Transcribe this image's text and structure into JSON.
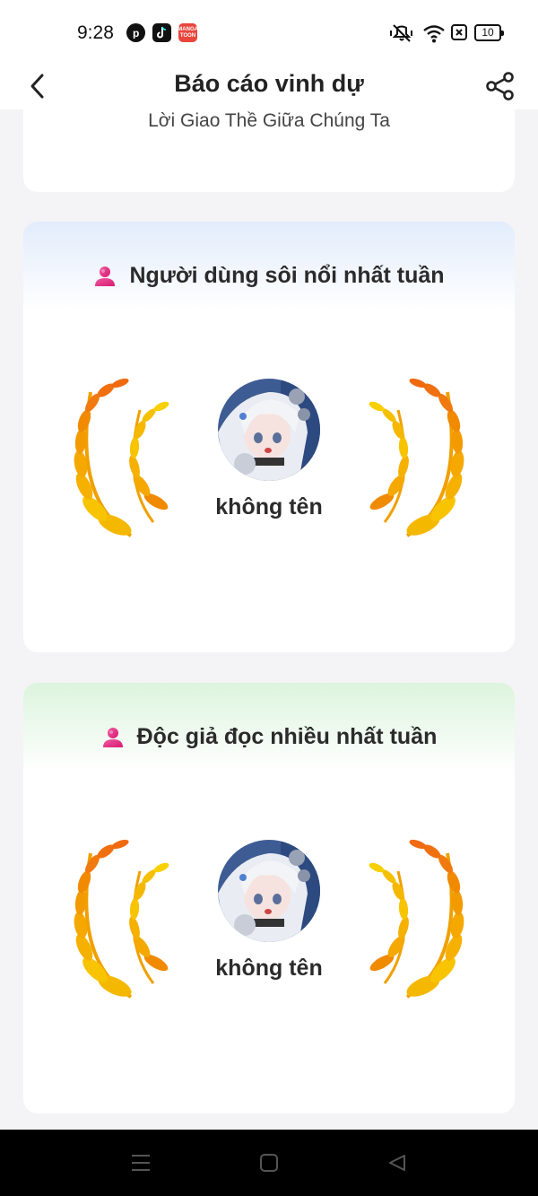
{
  "status": {
    "time": "9:28",
    "battery": "10",
    "manga_app": "MANGA TOON"
  },
  "header": {
    "title": "Báo cáo vinh dự"
  },
  "previous_card": {
    "text": "Lời Giao Thề Giữa Chúng Ta"
  },
  "honors": [
    {
      "title": "Người dùng sôi nổi nhất tuần",
      "user_name": "không tên",
      "accent": "#e2ecfb"
    },
    {
      "title": "Độc giả đọc nhiều nhất tuần",
      "user_name": "không tên",
      "accent": "#dcf4dd"
    }
  ],
  "icons": {
    "back": "chevron-left-icon",
    "share": "share-icon",
    "user": "user-icon",
    "laurel": "laurel-icon"
  },
  "colors": {
    "gold": "#f5b800",
    "orange": "#f07a10",
    "pink": "#e83e8c",
    "nav_bg": "#000000"
  }
}
